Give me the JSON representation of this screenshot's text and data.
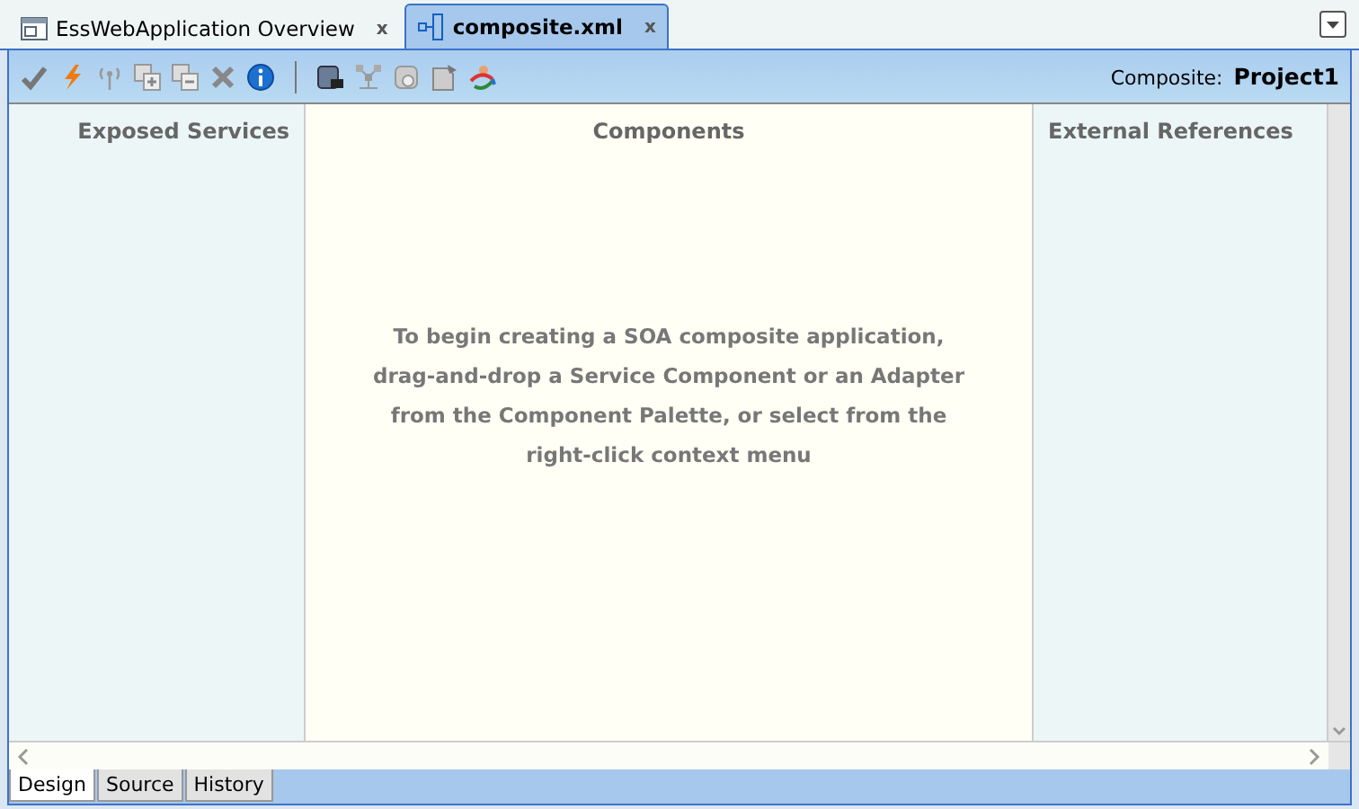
{
  "editor_tabs": [
    {
      "label": "EssWebApplication Overview",
      "selected": false,
      "close": "x"
    },
    {
      "label": "composite.xml",
      "selected": true,
      "close": "x"
    }
  ],
  "toolbar": {
    "composite_label": "Composite:",
    "composite_name": "Project1"
  },
  "canvas": {
    "columns": [
      {
        "title": "Exposed Services"
      },
      {
        "title": "Components"
      },
      {
        "title": "External References"
      }
    ],
    "hint_lines": [
      "To begin creating a SOA composite application,",
      "drag-and-drop a Service Component or an Adapter",
      "from the Component Palette, or select from the",
      "right-click context menu"
    ]
  },
  "view_tabs": [
    {
      "label": "Design",
      "selected": true
    },
    {
      "label": "Source",
      "selected": false
    },
    {
      "label": "History",
      "selected": false
    }
  ]
}
